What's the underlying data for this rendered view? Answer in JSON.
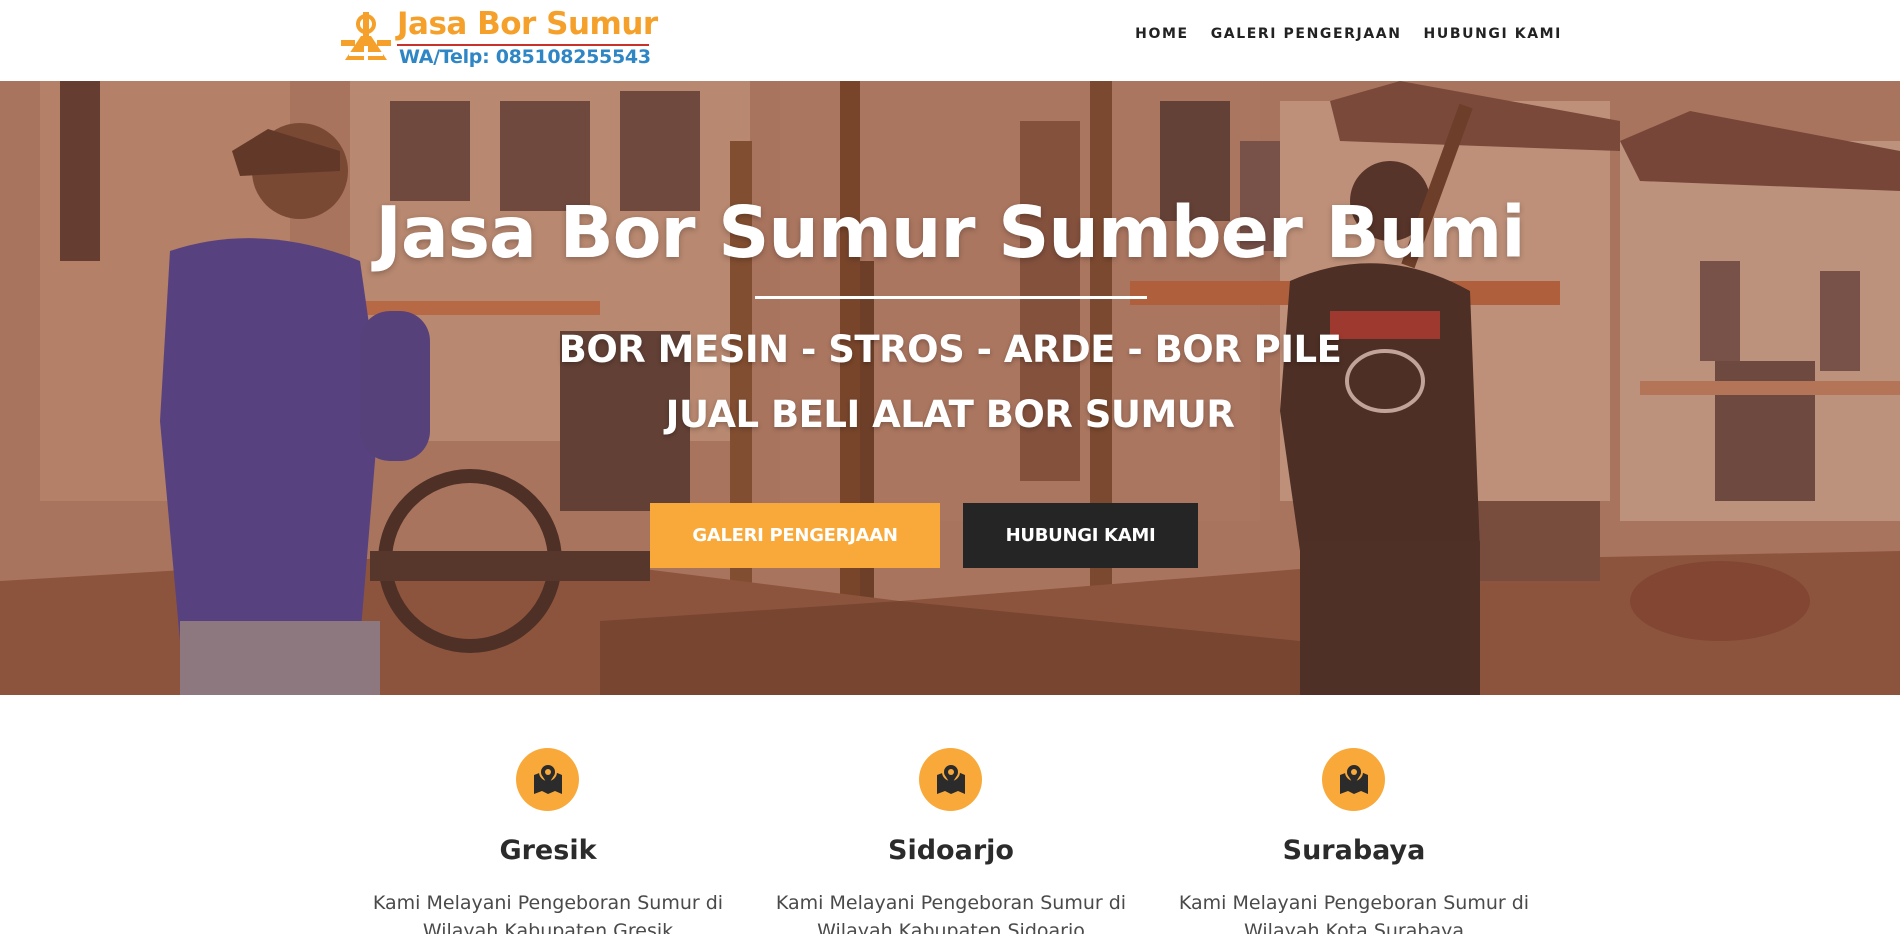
{
  "brand": {
    "title": "Jasa Bor Sumur",
    "subtitle": "WA/Telp: 085108255543",
    "logo_icon": "drill-rig-icon",
    "colors": {
      "title": "#f5a02a",
      "subtitle": "#2f86c5",
      "rule": "#c8322a"
    }
  },
  "nav": {
    "items": [
      {
        "label": "HOME"
      },
      {
        "label": "GALERI PENGERJAAN"
      },
      {
        "label": "HUBUNGI KAMI"
      }
    ]
  },
  "hero": {
    "title": "Jasa Bor Sumur Sumber Bumi",
    "line1": "BOR MESIN - STROS - ARDE - BOR PILE",
    "line2": "JUAL BELI ALAT BOR SUMUR",
    "buttons": {
      "primary": "GALERI PENGERJAAN",
      "secondary": "HUBUNGI KAMI"
    },
    "colors": {
      "primary": "#f9a93a",
      "secondary": "#252525"
    }
  },
  "areas": [
    {
      "icon": "map-pin-icon",
      "title": "Gresik",
      "text": "Kami Melayani Pengeboran Sumur di Wilayah Kabupaten Gresik"
    },
    {
      "icon": "map-pin-icon",
      "title": "Sidoarjo",
      "text": "Kami Melayani Pengeboran Sumur di Wilayah Kabupaten Sidoarjo"
    },
    {
      "icon": "map-pin-icon",
      "title": "Surabaya",
      "text": "Kami Melayani Pengeboran Sumur di Wilayah Kota Surabaya"
    }
  ]
}
